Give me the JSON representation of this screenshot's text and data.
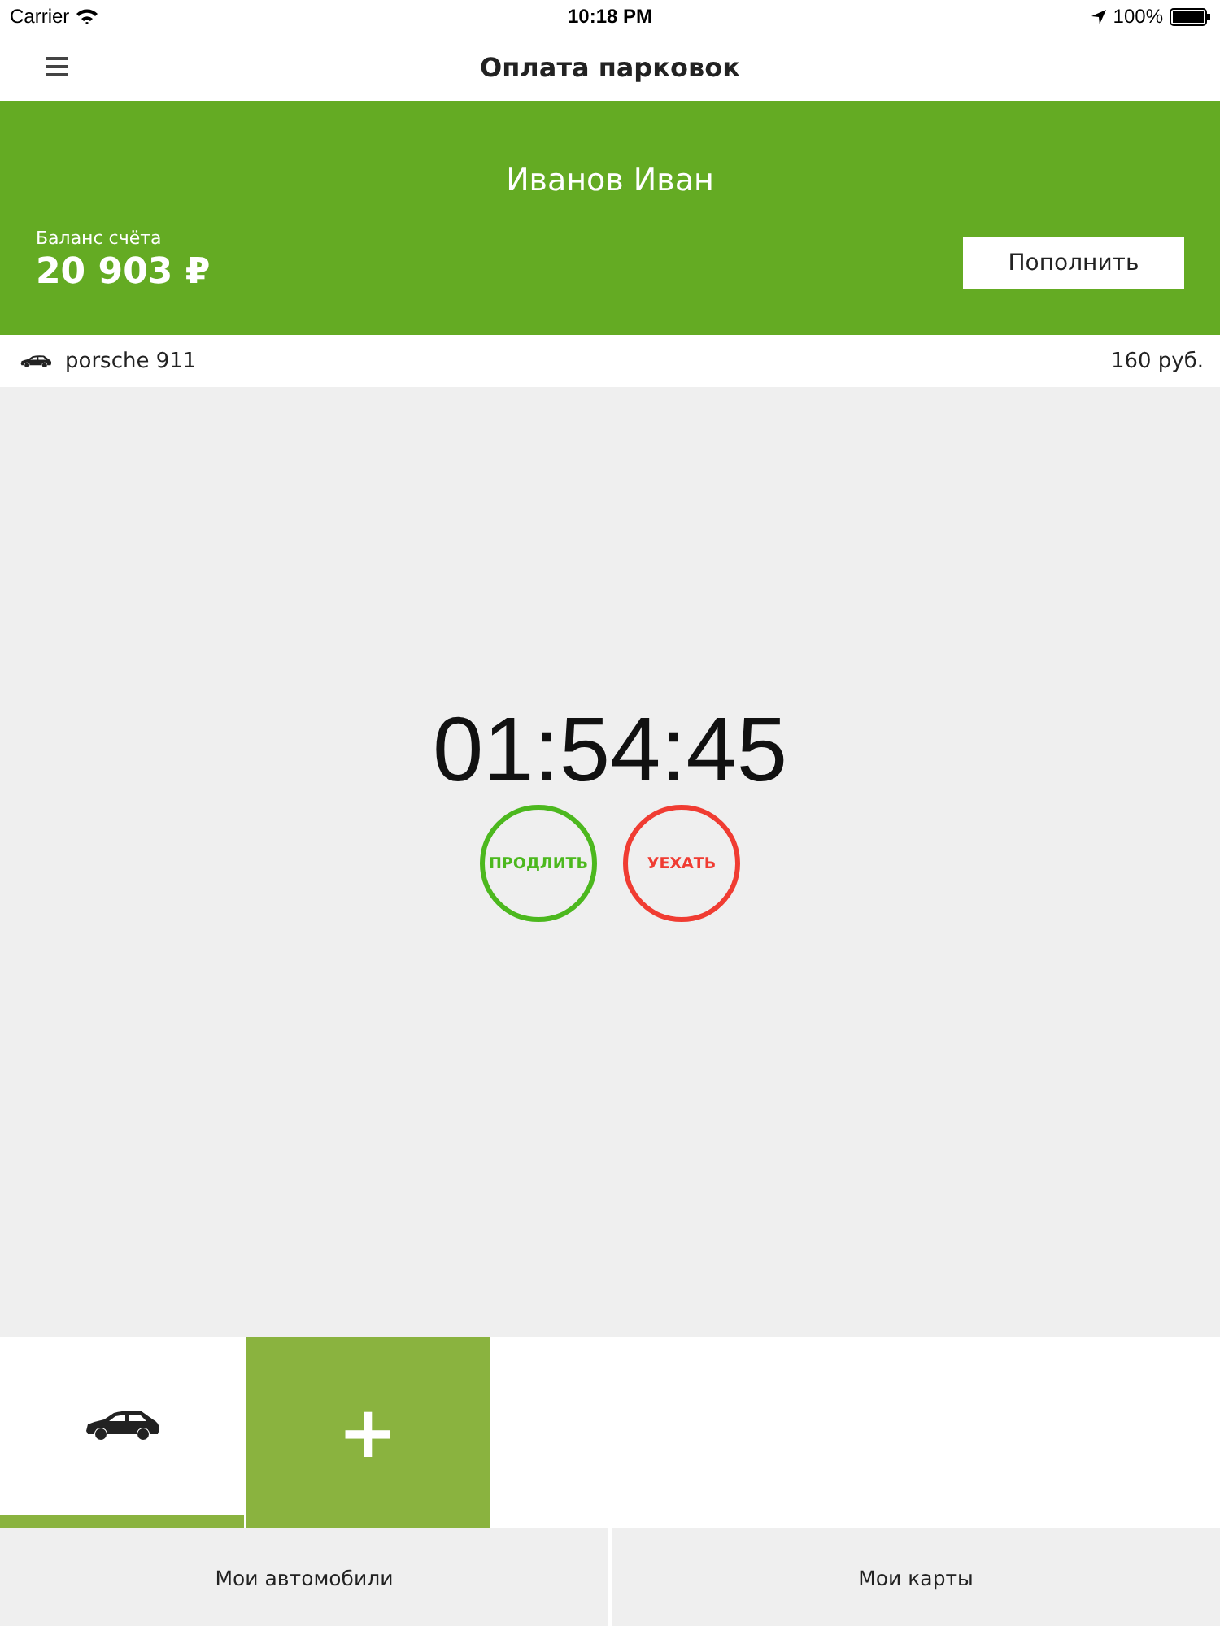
{
  "status_bar": {
    "carrier": "Carrier",
    "time": "10:18 PM",
    "battery": "100%"
  },
  "nav": {
    "title": "Оплата парковок"
  },
  "account": {
    "name": "Иванов Иван",
    "balance_label": "Баланс счёта",
    "balance": "20 903 ₽",
    "top_up": "Пополнить"
  },
  "current_car": {
    "name": "porsche 911",
    "price": "160 руб."
  },
  "timer": {
    "time": "01:54:45",
    "actions": [
      {
        "label": "ПРОДЛИТЬ",
        "color": "#4cb81e"
      },
      {
        "label": "УЕХАТЬ",
        "color": "#f03c32"
      }
    ]
  },
  "cars": [
    {
      "kind": "car",
      "selected": true
    },
    {
      "kind": "add",
      "label": "+"
    }
  ],
  "tabs": [
    {
      "label": "Мои автомобили"
    },
    {
      "label": "Мои карты"
    }
  ]
}
